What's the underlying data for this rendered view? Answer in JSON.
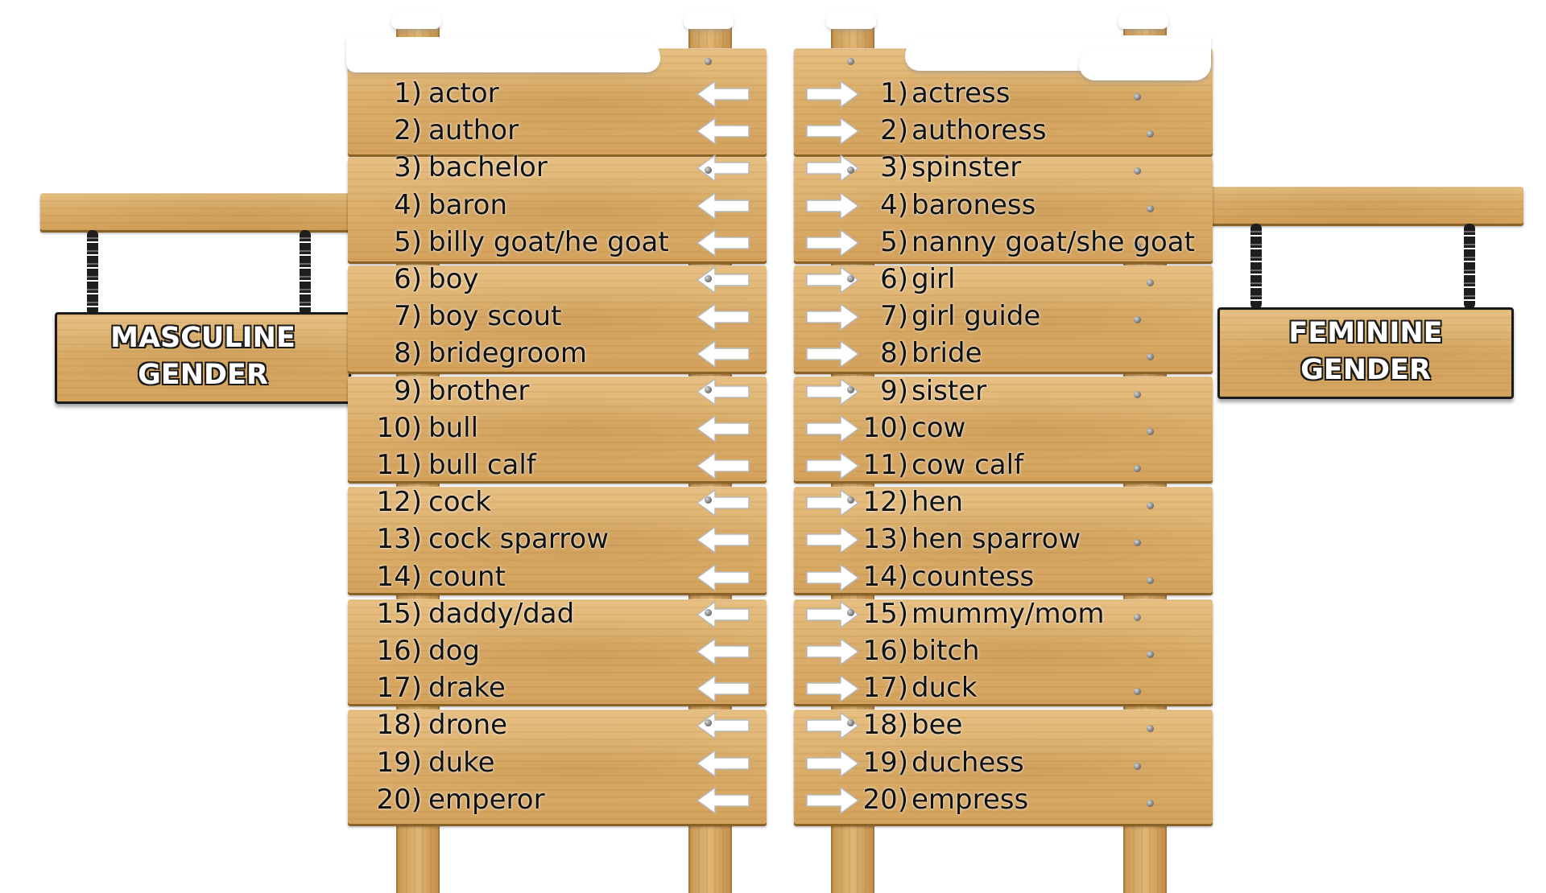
{
  "signs": {
    "left_label_line1": "MASCULINE",
    "left_label_line2": "GENDER",
    "right_label_line1": "FEMININE",
    "right_label_line2": "GENDER"
  },
  "masculine": [
    {
      "num": "1)",
      "word": "actor"
    },
    {
      "num": "2)",
      "word": "author"
    },
    {
      "num": "3)",
      "word": "bachelor"
    },
    {
      "num": "4)",
      "word": "baron"
    },
    {
      "num": "5)",
      "word": "billy goat/he goat"
    },
    {
      "num": "6)",
      "word": "boy"
    },
    {
      "num": "7)",
      "word": "boy scout"
    },
    {
      "num": "8)",
      "word": "bridegroom"
    },
    {
      "num": "9)",
      "word": "brother"
    },
    {
      "num": "10)",
      "word": "bull"
    },
    {
      "num": "11)",
      "word": "bull calf"
    },
    {
      "num": "12)",
      "word": "cock"
    },
    {
      "num": "13)",
      "word": "cock sparrow"
    },
    {
      "num": "14)",
      "word": "count"
    },
    {
      "num": "15)",
      "word": "daddy/dad"
    },
    {
      "num": "16)",
      "word": "dog"
    },
    {
      "num": "17)",
      "word": "drake"
    },
    {
      "num": "18)",
      "word": "drone"
    },
    {
      "num": "19)",
      "word": "duke"
    },
    {
      "num": "20)",
      "word": "emperor"
    }
  ],
  "feminine": [
    {
      "num": "1)",
      "word": "actress"
    },
    {
      "num": "2)",
      "word": "authoress"
    },
    {
      "num": "3)",
      "word": "spinster"
    },
    {
      "num": "4)",
      "word": "baroness"
    },
    {
      "num": "5)",
      "word": "nanny goat/she goat"
    },
    {
      "num": "6)",
      "word": "girl"
    },
    {
      "num": "7)",
      "word": "girl guide"
    },
    {
      "num": "8)",
      "word": "bride"
    },
    {
      "num": "9)",
      "word": "sister"
    },
    {
      "num": "10)",
      "word": "cow"
    },
    {
      "num": "11)",
      "word": "cow calf"
    },
    {
      "num": "12)",
      "word": "hen"
    },
    {
      "num": "13)",
      "word": "hen sparrow"
    },
    {
      "num": "14)",
      "word": "countess"
    },
    {
      "num": "15)",
      "word": "mummy/mom"
    },
    {
      "num": "16)",
      "word": "bitch"
    },
    {
      "num": "17)",
      "word": "duck"
    },
    {
      "num": "18)",
      "word": "bee"
    },
    {
      "num": "19)",
      "word": "duchess"
    },
    {
      "num": "20)",
      "word": "empress"
    }
  ],
  "colors": {
    "wood": "#ddb06d",
    "wood_dark": "#a77a3c",
    "text": "#111111",
    "arrow": "#ffffff",
    "snow": "#ffffff"
  },
  "icons": [
    "arrow-left-icon",
    "arrow-right-icon",
    "chain-icon",
    "nail-icon",
    "snow-cap"
  ]
}
